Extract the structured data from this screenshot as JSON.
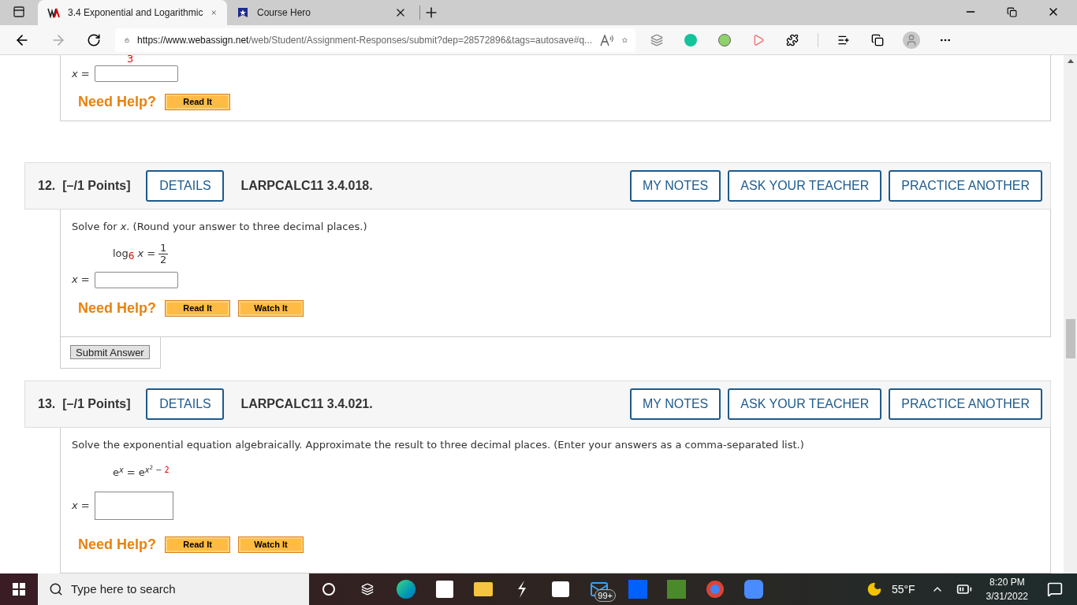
{
  "browser": {
    "tabs": [
      {
        "title": "3.4 Exponential and Logarithmic",
        "selected": true,
        "kind": "webassign"
      },
      {
        "title": "Course Hero",
        "selected": false,
        "kind": "coursehero"
      }
    ],
    "url_host": "https://www.webassign.net",
    "url_path": "/web/Student/Assignment-Responses/submit?dep=28572896&tags=autosave#q..."
  },
  "previous_question": {
    "fragment": "3",
    "answer_label": "x =",
    "help_label": "Need Help?",
    "help_buttons": [
      "Read It"
    ]
  },
  "questions": [
    {
      "number": "12.",
      "points": "[–/1 Points]",
      "details": "DETAILS",
      "code": "LARPCALC11 3.4.018.",
      "actions": [
        "MY NOTES",
        "ASK YOUR TEACHER",
        "PRACTICE ANOTHER"
      ],
      "prompt": "Solve for *x*. (Round your answer to three decimal places.)",
      "equation": {
        "kind": "log",
        "func": "log",
        "base": "6",
        "lhs_var": "x",
        "equals": "=",
        "numerator": "1",
        "denominator": "2"
      },
      "answer_label": "x =",
      "kind": "short",
      "help_label": "Need Help?",
      "help_buttons": [
        "Read It",
        "Watch It"
      ],
      "submit": "Submit Answer"
    },
    {
      "number": "13.",
      "points": "[–/1 Points]",
      "details": "DETAILS",
      "code": "LARPCALC11 3.4.021.",
      "actions": [
        "MY NOTES",
        "ASK YOUR TEACHER",
        "PRACTICE ANOTHER"
      ],
      "prompt": "Solve the exponential equation algebraically. Approximate the result to three decimal places. (Enter your answers as a comma-separated list.)",
      "equation": {
        "kind": "exp",
        "lhs_base": "e",
        "lhs_exp": "x",
        "equals": "=",
        "rhs_base": "e",
        "rhs_exp": "x",
        "rhs_exp_power": "2",
        "minus": "−",
        "constant": "2"
      },
      "answer_label": "x =",
      "kind": "tall",
      "help_label": "Need Help?",
      "help_buttons": [
        "Read It",
        "Watch It"
      ]
    }
  ],
  "taskbar": {
    "search_placeholder": "Type here to search",
    "mail_badge": "99+",
    "temperature": "55°F",
    "time": "8:20 PM",
    "date": "3/31/2022"
  }
}
